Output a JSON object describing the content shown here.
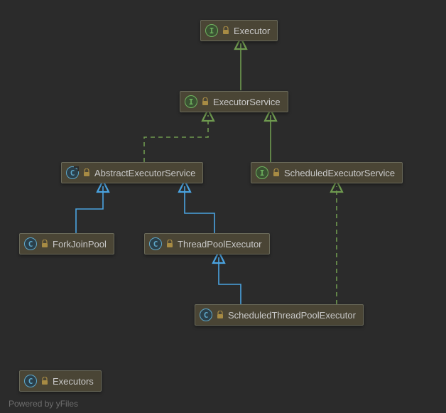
{
  "nodes": {
    "executor": {
      "kind": "I",
      "label": "Executor"
    },
    "executorService": {
      "kind": "I",
      "label": "ExecutorService"
    },
    "abstractExecutorService": {
      "kind": "Ch",
      "label": "AbstractExecutorService"
    },
    "scheduledExecutorService": {
      "kind": "I",
      "label": "ScheduledExecutorService"
    },
    "forkJoinPool": {
      "kind": "C",
      "label": "ForkJoinPool"
    },
    "threadPoolExecutor": {
      "kind": "C",
      "label": "ThreadPoolExecutor"
    },
    "scheduledThreadPoolExecutor": {
      "kind": "C",
      "label": "ScheduledThreadPoolExecutor"
    },
    "executors": {
      "kind": "C",
      "label": "Executors"
    }
  },
  "footer": "Powered by yFiles",
  "colors": {
    "implements": "#6f9a4f",
    "extends": "#4aa3e0"
  }
}
